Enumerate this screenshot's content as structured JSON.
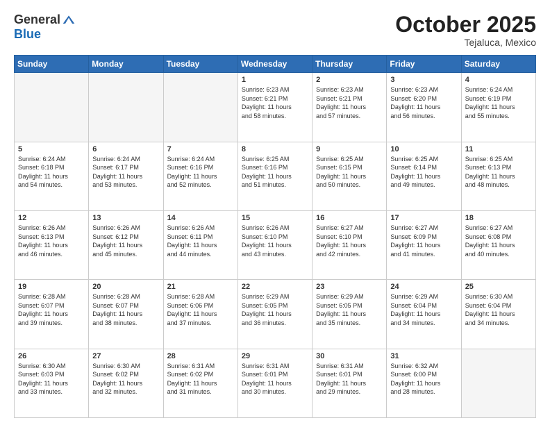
{
  "header": {
    "logo_general": "General",
    "logo_blue": "Blue",
    "month": "October 2025",
    "location": "Tejaluca, Mexico"
  },
  "days_of_week": [
    "Sunday",
    "Monday",
    "Tuesday",
    "Wednesday",
    "Thursday",
    "Friday",
    "Saturday"
  ],
  "weeks": [
    [
      {
        "day": "",
        "info": ""
      },
      {
        "day": "",
        "info": ""
      },
      {
        "day": "",
        "info": ""
      },
      {
        "day": "1",
        "info": "Sunrise: 6:23 AM\nSunset: 6:21 PM\nDaylight: 11 hours\nand 58 minutes."
      },
      {
        "day": "2",
        "info": "Sunrise: 6:23 AM\nSunset: 6:21 PM\nDaylight: 11 hours\nand 57 minutes."
      },
      {
        "day": "3",
        "info": "Sunrise: 6:23 AM\nSunset: 6:20 PM\nDaylight: 11 hours\nand 56 minutes."
      },
      {
        "day": "4",
        "info": "Sunrise: 6:24 AM\nSunset: 6:19 PM\nDaylight: 11 hours\nand 55 minutes."
      }
    ],
    [
      {
        "day": "5",
        "info": "Sunrise: 6:24 AM\nSunset: 6:18 PM\nDaylight: 11 hours\nand 54 minutes."
      },
      {
        "day": "6",
        "info": "Sunrise: 6:24 AM\nSunset: 6:17 PM\nDaylight: 11 hours\nand 53 minutes."
      },
      {
        "day": "7",
        "info": "Sunrise: 6:24 AM\nSunset: 6:16 PM\nDaylight: 11 hours\nand 52 minutes."
      },
      {
        "day": "8",
        "info": "Sunrise: 6:25 AM\nSunset: 6:16 PM\nDaylight: 11 hours\nand 51 minutes."
      },
      {
        "day": "9",
        "info": "Sunrise: 6:25 AM\nSunset: 6:15 PM\nDaylight: 11 hours\nand 50 minutes."
      },
      {
        "day": "10",
        "info": "Sunrise: 6:25 AM\nSunset: 6:14 PM\nDaylight: 11 hours\nand 49 minutes."
      },
      {
        "day": "11",
        "info": "Sunrise: 6:25 AM\nSunset: 6:13 PM\nDaylight: 11 hours\nand 48 minutes."
      }
    ],
    [
      {
        "day": "12",
        "info": "Sunrise: 6:26 AM\nSunset: 6:13 PM\nDaylight: 11 hours\nand 46 minutes."
      },
      {
        "day": "13",
        "info": "Sunrise: 6:26 AM\nSunset: 6:12 PM\nDaylight: 11 hours\nand 45 minutes."
      },
      {
        "day": "14",
        "info": "Sunrise: 6:26 AM\nSunset: 6:11 PM\nDaylight: 11 hours\nand 44 minutes."
      },
      {
        "day": "15",
        "info": "Sunrise: 6:26 AM\nSunset: 6:10 PM\nDaylight: 11 hours\nand 43 minutes."
      },
      {
        "day": "16",
        "info": "Sunrise: 6:27 AM\nSunset: 6:10 PM\nDaylight: 11 hours\nand 42 minutes."
      },
      {
        "day": "17",
        "info": "Sunrise: 6:27 AM\nSunset: 6:09 PM\nDaylight: 11 hours\nand 41 minutes."
      },
      {
        "day": "18",
        "info": "Sunrise: 6:27 AM\nSunset: 6:08 PM\nDaylight: 11 hours\nand 40 minutes."
      }
    ],
    [
      {
        "day": "19",
        "info": "Sunrise: 6:28 AM\nSunset: 6:07 PM\nDaylight: 11 hours\nand 39 minutes."
      },
      {
        "day": "20",
        "info": "Sunrise: 6:28 AM\nSunset: 6:07 PM\nDaylight: 11 hours\nand 38 minutes."
      },
      {
        "day": "21",
        "info": "Sunrise: 6:28 AM\nSunset: 6:06 PM\nDaylight: 11 hours\nand 37 minutes."
      },
      {
        "day": "22",
        "info": "Sunrise: 6:29 AM\nSunset: 6:05 PM\nDaylight: 11 hours\nand 36 minutes."
      },
      {
        "day": "23",
        "info": "Sunrise: 6:29 AM\nSunset: 6:05 PM\nDaylight: 11 hours\nand 35 minutes."
      },
      {
        "day": "24",
        "info": "Sunrise: 6:29 AM\nSunset: 6:04 PM\nDaylight: 11 hours\nand 34 minutes."
      },
      {
        "day": "25",
        "info": "Sunrise: 6:30 AM\nSunset: 6:04 PM\nDaylight: 11 hours\nand 34 minutes."
      }
    ],
    [
      {
        "day": "26",
        "info": "Sunrise: 6:30 AM\nSunset: 6:03 PM\nDaylight: 11 hours\nand 33 minutes."
      },
      {
        "day": "27",
        "info": "Sunrise: 6:30 AM\nSunset: 6:02 PM\nDaylight: 11 hours\nand 32 minutes."
      },
      {
        "day": "28",
        "info": "Sunrise: 6:31 AM\nSunset: 6:02 PM\nDaylight: 11 hours\nand 31 minutes."
      },
      {
        "day": "29",
        "info": "Sunrise: 6:31 AM\nSunset: 6:01 PM\nDaylight: 11 hours\nand 30 minutes."
      },
      {
        "day": "30",
        "info": "Sunrise: 6:31 AM\nSunset: 6:01 PM\nDaylight: 11 hours\nand 29 minutes."
      },
      {
        "day": "31",
        "info": "Sunrise: 6:32 AM\nSunset: 6:00 PM\nDaylight: 11 hours\nand 28 minutes."
      },
      {
        "day": "",
        "info": ""
      }
    ]
  ]
}
